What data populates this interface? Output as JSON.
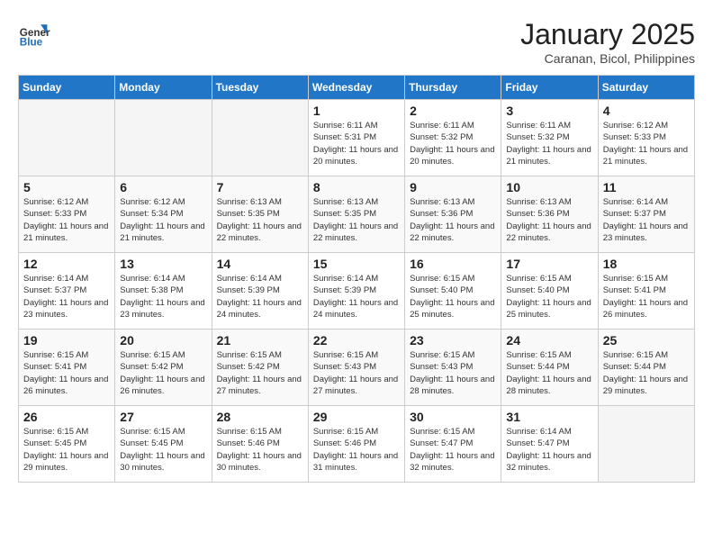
{
  "header": {
    "logo_line1": "General",
    "logo_line2": "Blue",
    "title": "January 2025",
    "subtitle": "Caranan, Bicol, Philippines"
  },
  "days_of_week": [
    "Sunday",
    "Monday",
    "Tuesday",
    "Wednesday",
    "Thursday",
    "Friday",
    "Saturday"
  ],
  "weeks": [
    [
      {
        "day": "",
        "empty": true
      },
      {
        "day": "",
        "empty": true
      },
      {
        "day": "",
        "empty": true
      },
      {
        "day": "1",
        "sunrise": "Sunrise: 6:11 AM",
        "sunset": "Sunset: 5:31 PM",
        "daylight": "Daylight: 11 hours and 20 minutes."
      },
      {
        "day": "2",
        "sunrise": "Sunrise: 6:11 AM",
        "sunset": "Sunset: 5:32 PM",
        "daylight": "Daylight: 11 hours and 20 minutes."
      },
      {
        "day": "3",
        "sunrise": "Sunrise: 6:11 AM",
        "sunset": "Sunset: 5:32 PM",
        "daylight": "Daylight: 11 hours and 21 minutes."
      },
      {
        "day": "4",
        "sunrise": "Sunrise: 6:12 AM",
        "sunset": "Sunset: 5:33 PM",
        "daylight": "Daylight: 11 hours and 21 minutes."
      }
    ],
    [
      {
        "day": "5",
        "sunrise": "Sunrise: 6:12 AM",
        "sunset": "Sunset: 5:33 PM",
        "daylight": "Daylight: 11 hours and 21 minutes."
      },
      {
        "day": "6",
        "sunrise": "Sunrise: 6:12 AM",
        "sunset": "Sunset: 5:34 PM",
        "daylight": "Daylight: 11 hours and 21 minutes."
      },
      {
        "day": "7",
        "sunrise": "Sunrise: 6:13 AM",
        "sunset": "Sunset: 5:35 PM",
        "daylight": "Daylight: 11 hours and 22 minutes."
      },
      {
        "day": "8",
        "sunrise": "Sunrise: 6:13 AM",
        "sunset": "Sunset: 5:35 PM",
        "daylight": "Daylight: 11 hours and 22 minutes."
      },
      {
        "day": "9",
        "sunrise": "Sunrise: 6:13 AM",
        "sunset": "Sunset: 5:36 PM",
        "daylight": "Daylight: 11 hours and 22 minutes."
      },
      {
        "day": "10",
        "sunrise": "Sunrise: 6:13 AM",
        "sunset": "Sunset: 5:36 PM",
        "daylight": "Daylight: 11 hours and 22 minutes."
      },
      {
        "day": "11",
        "sunrise": "Sunrise: 6:14 AM",
        "sunset": "Sunset: 5:37 PM",
        "daylight": "Daylight: 11 hours and 23 minutes."
      }
    ],
    [
      {
        "day": "12",
        "sunrise": "Sunrise: 6:14 AM",
        "sunset": "Sunset: 5:37 PM",
        "daylight": "Daylight: 11 hours and 23 minutes."
      },
      {
        "day": "13",
        "sunrise": "Sunrise: 6:14 AM",
        "sunset": "Sunset: 5:38 PM",
        "daylight": "Daylight: 11 hours and 23 minutes."
      },
      {
        "day": "14",
        "sunrise": "Sunrise: 6:14 AM",
        "sunset": "Sunset: 5:39 PM",
        "daylight": "Daylight: 11 hours and 24 minutes."
      },
      {
        "day": "15",
        "sunrise": "Sunrise: 6:14 AM",
        "sunset": "Sunset: 5:39 PM",
        "daylight": "Daylight: 11 hours and 24 minutes."
      },
      {
        "day": "16",
        "sunrise": "Sunrise: 6:15 AM",
        "sunset": "Sunset: 5:40 PM",
        "daylight": "Daylight: 11 hours and 25 minutes."
      },
      {
        "day": "17",
        "sunrise": "Sunrise: 6:15 AM",
        "sunset": "Sunset: 5:40 PM",
        "daylight": "Daylight: 11 hours and 25 minutes."
      },
      {
        "day": "18",
        "sunrise": "Sunrise: 6:15 AM",
        "sunset": "Sunset: 5:41 PM",
        "daylight": "Daylight: 11 hours and 26 minutes."
      }
    ],
    [
      {
        "day": "19",
        "sunrise": "Sunrise: 6:15 AM",
        "sunset": "Sunset: 5:41 PM",
        "daylight": "Daylight: 11 hours and 26 minutes."
      },
      {
        "day": "20",
        "sunrise": "Sunrise: 6:15 AM",
        "sunset": "Sunset: 5:42 PM",
        "daylight": "Daylight: 11 hours and 26 minutes."
      },
      {
        "day": "21",
        "sunrise": "Sunrise: 6:15 AM",
        "sunset": "Sunset: 5:42 PM",
        "daylight": "Daylight: 11 hours and 27 minutes."
      },
      {
        "day": "22",
        "sunrise": "Sunrise: 6:15 AM",
        "sunset": "Sunset: 5:43 PM",
        "daylight": "Daylight: 11 hours and 27 minutes."
      },
      {
        "day": "23",
        "sunrise": "Sunrise: 6:15 AM",
        "sunset": "Sunset: 5:43 PM",
        "daylight": "Daylight: 11 hours and 28 minutes."
      },
      {
        "day": "24",
        "sunrise": "Sunrise: 6:15 AM",
        "sunset": "Sunset: 5:44 PM",
        "daylight": "Daylight: 11 hours and 28 minutes."
      },
      {
        "day": "25",
        "sunrise": "Sunrise: 6:15 AM",
        "sunset": "Sunset: 5:44 PM",
        "daylight": "Daylight: 11 hours and 29 minutes."
      }
    ],
    [
      {
        "day": "26",
        "sunrise": "Sunrise: 6:15 AM",
        "sunset": "Sunset: 5:45 PM",
        "daylight": "Daylight: 11 hours and 29 minutes."
      },
      {
        "day": "27",
        "sunrise": "Sunrise: 6:15 AM",
        "sunset": "Sunset: 5:45 PM",
        "daylight": "Daylight: 11 hours and 30 minutes."
      },
      {
        "day": "28",
        "sunrise": "Sunrise: 6:15 AM",
        "sunset": "Sunset: 5:46 PM",
        "daylight": "Daylight: 11 hours and 30 minutes."
      },
      {
        "day": "29",
        "sunrise": "Sunrise: 6:15 AM",
        "sunset": "Sunset: 5:46 PM",
        "daylight": "Daylight: 11 hours and 31 minutes."
      },
      {
        "day": "30",
        "sunrise": "Sunrise: 6:15 AM",
        "sunset": "Sunset: 5:47 PM",
        "daylight": "Daylight: 11 hours and 32 minutes."
      },
      {
        "day": "31",
        "sunrise": "Sunrise: 6:14 AM",
        "sunset": "Sunset: 5:47 PM",
        "daylight": "Daylight: 11 hours and 32 minutes."
      },
      {
        "day": "",
        "empty": true
      }
    ]
  ]
}
